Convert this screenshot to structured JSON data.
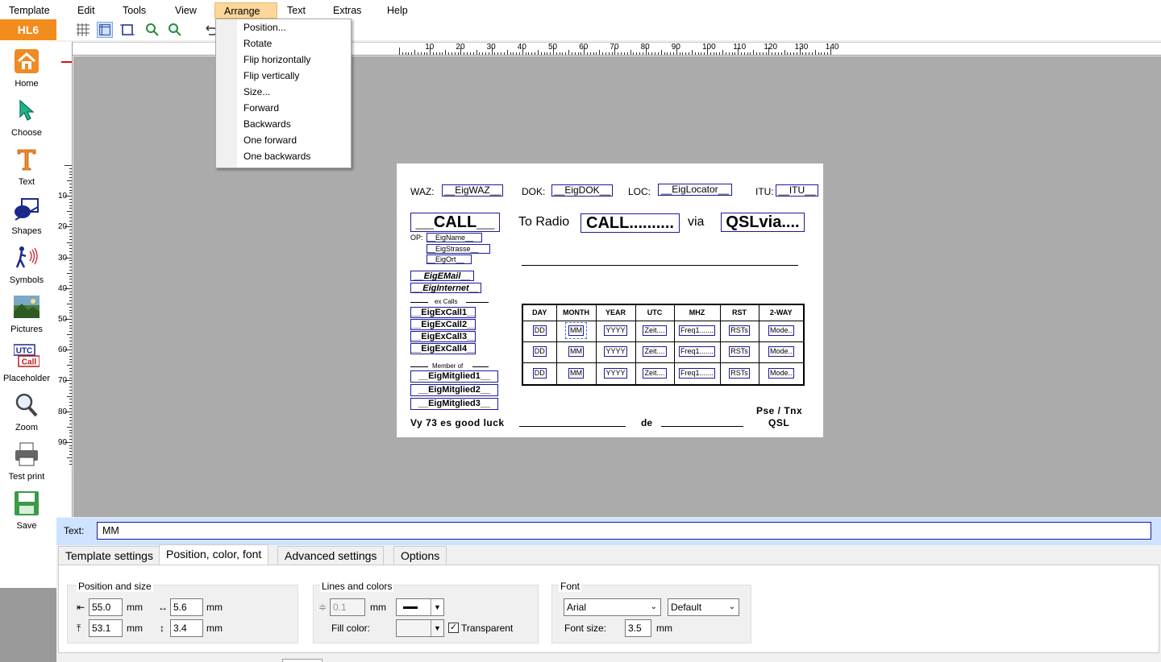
{
  "menubar": {
    "items": [
      "Template",
      "Edit",
      "Tools",
      "View",
      "Arrange",
      "Text",
      "Extras",
      "Help"
    ]
  },
  "sidebar": {
    "brand": "HL6",
    "items": [
      {
        "label": "Home",
        "icon": "home-icon"
      },
      {
        "label": "Choose",
        "icon": "pointer-icon"
      },
      {
        "label": "Text",
        "icon": "text-icon"
      },
      {
        "label": "Shapes",
        "icon": "shapes-icon"
      },
      {
        "label": "Symbols",
        "icon": "symbols-icon"
      },
      {
        "label": "Pictures",
        "icon": "pictures-icon"
      },
      {
        "label": "Placeholder",
        "icon": "placeholder-icon"
      },
      {
        "label": "Zoom",
        "icon": "zoom-icon"
      },
      {
        "label": "Test print",
        "icon": "printer-icon"
      },
      {
        "label": "Save",
        "icon": "save-icon"
      }
    ],
    "placeholder_icon_text": [
      "UTC",
      "Call"
    ]
  },
  "arrange_menu": {
    "items": [
      "Position...",
      "Rotate",
      "Flip horizontally",
      "Flip vertically",
      "Size...",
      "Forward",
      "Backwards",
      "One forward",
      "One backwards"
    ]
  },
  "ruler": {
    "h": [
      "10",
      "20",
      "30",
      "40",
      "50",
      "60",
      "70",
      "80",
      "90",
      "100",
      "110",
      "120",
      "130",
      "140"
    ],
    "v": [
      "10",
      "20",
      "30",
      "40",
      "50",
      "60",
      "70",
      "80",
      "90"
    ]
  },
  "card": {
    "waz_label": "WAZ:",
    "waz": "__EigWAZ__",
    "dok_label": "DOK:",
    "dok": "__EigDOK__",
    "loc_label": "LOC:",
    "loc": "__EigLocator__",
    "itu_label": "ITU:",
    "itu": "__ITU__",
    "call": "__CALL__",
    "to_radio": "To Radio",
    "call2": "CALL..........",
    "via": "via",
    "qslvia": "QSLvia....",
    "op_label": "OP:",
    "name": "__EigName__",
    "strasse": "__EigStrasse__",
    "ort": "__EigOrt__",
    "email": "__EigEMail__",
    "internet": "__EigInternet__",
    "excalls_label": "ex Calls",
    "excalls": [
      "__EigExCall1__",
      "__EigExCall2__",
      "__EigExCall3__",
      "__EigExCall4__"
    ],
    "member_label": "Member of",
    "members": [
      "__EigMitglied1__",
      "__EigMitglied2__",
      "__EigMitglied3__"
    ],
    "table_headers": [
      "DAY",
      "MONTH",
      "YEAR",
      "UTC",
      "MHZ",
      "RST",
      "2-WAY"
    ],
    "table_row": [
      "DD",
      "MM",
      "YYYY",
      "Zeit....",
      "Freq1.......",
      "RSTs",
      "Mode.."
    ],
    "vy73": "Vy 73 es good luck",
    "de": "de",
    "pse": "Pse / Tnx",
    "qsl": "QSL"
  },
  "textbar": {
    "label": "Text:",
    "value": "MM"
  },
  "tabs": [
    "Template settings",
    "Position, color, font",
    "Advanced settings",
    "Options"
  ],
  "position": {
    "group": "Position and size",
    "x": "55.0",
    "w": "5.6",
    "y": "53.1",
    "h": "3.4",
    "unit": "mm"
  },
  "lines": {
    "group": "Lines and colors",
    "width": "0.1",
    "unit": "mm",
    "fill_label": "Fill color:",
    "transparent_label": "Transparent",
    "transparent_checked": true
  },
  "font": {
    "group": "Font",
    "family": "Arial",
    "style": "Default",
    "size_label": "Font size:",
    "size": "3.5",
    "unit": "mm"
  }
}
